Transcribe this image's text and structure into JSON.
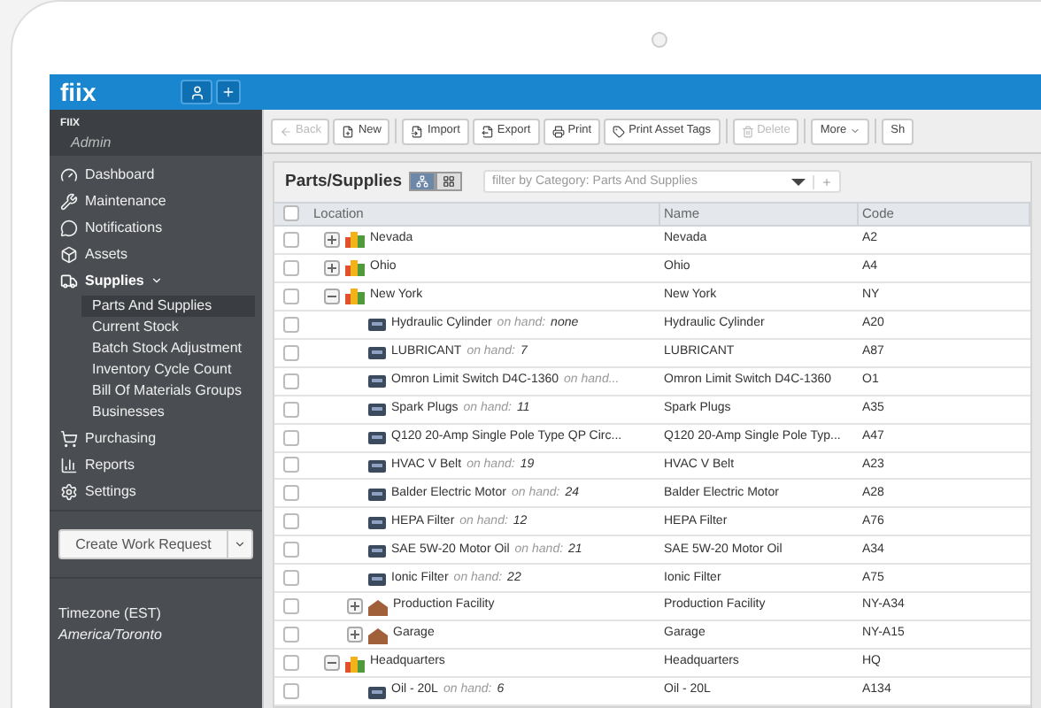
{
  "app": {
    "logo": "fiix",
    "account": {
      "company": "FIIX",
      "role": "Admin"
    }
  },
  "sidebar": {
    "items": [
      {
        "label": "Dashboard",
        "selected": false
      },
      {
        "label": "Maintenance",
        "selected": false
      },
      {
        "label": "Notifications",
        "selected": false
      },
      {
        "label": "Assets",
        "selected": false
      },
      {
        "label": "Supplies",
        "selected": true,
        "expanded": true,
        "children": [
          {
            "label": "Parts And Supplies",
            "selected": true
          },
          {
            "label": "Current Stock",
            "selected": false
          },
          {
            "label": "Batch Stock Adjustment",
            "selected": false
          },
          {
            "label": "Inventory Cycle Count",
            "selected": false
          },
          {
            "label": "Bill Of Materials Groups",
            "selected": false
          },
          {
            "label": "Businesses",
            "selected": false
          }
        ]
      },
      {
        "label": "Purchasing",
        "selected": false
      },
      {
        "label": "Reports",
        "selected": false
      },
      {
        "label": "Settings",
        "selected": false
      }
    ],
    "action_button": "Create Work Request",
    "timezone": {
      "label": "Timezone (EST)",
      "value": "America/Toronto"
    }
  },
  "toolbar": [
    {
      "label": "Back",
      "disabled": true
    },
    {
      "label": "New",
      "disabled": false
    },
    {
      "label": "Import",
      "disabled": false
    },
    {
      "label": "Export",
      "disabled": false
    },
    {
      "label": "Print",
      "disabled": false
    },
    {
      "label": "Print Asset Tags",
      "disabled": false
    },
    {
      "label": "Delete",
      "disabled": true
    },
    {
      "label": "More",
      "disabled": false
    },
    {
      "label": "Sh",
      "disabled": false
    }
  ],
  "panel": {
    "title": "Parts/Supplies",
    "views": [
      {
        "kind": "tree",
        "selected": true
      },
      {
        "kind": "grid",
        "selected": false
      }
    ],
    "filter": {
      "placeholder": "filter by Category: Parts And Supplies"
    }
  },
  "table": {
    "columns": [
      "Location",
      "Name",
      "Code"
    ],
    "all_checked": false,
    "rows": [
      {
        "kind": "site",
        "location": "Nevada",
        "name": "Nevada",
        "code": "A2",
        "checked": false,
        "expanded": false
      },
      {
        "kind": "site",
        "location": "Ohio",
        "name": "Ohio",
        "code": "A4",
        "checked": false,
        "expanded": false
      },
      {
        "kind": "site",
        "location": "New York",
        "name": "New York",
        "code": "NY",
        "checked": false,
        "expanded": true,
        "children": [
          {
            "kind": "part",
            "location": "Hydraulic Cylinder",
            "on_hand_label": "on hand:",
            "on_hand": "none",
            "name": "Hydraulic Cylinder",
            "code": "A20",
            "checked": false
          },
          {
            "kind": "part",
            "location": "LUBRICANT",
            "on_hand_label": "on hand:",
            "on_hand": "7",
            "name": "LUBRICANT",
            "code": "A87",
            "checked": false
          },
          {
            "kind": "part",
            "location": "Omron Limit Switch D4C-1360",
            "on_hand_label": "on hand...",
            "name": "Omron Limit Switch D4C-1360",
            "code": "O1",
            "checked": false
          },
          {
            "kind": "part",
            "location": "Spark Plugs",
            "on_hand_label": "on hand:",
            "on_hand": "11",
            "name": "Spark Plugs",
            "code": "A35",
            "checked": false
          },
          {
            "kind": "part",
            "location": "Q120 20-Amp Single Pole Type QP Circ...",
            "name": "Q120 20-Amp Single Pole Typ...",
            "code": "A47",
            "checked": false
          },
          {
            "kind": "part",
            "location": "HVAC V Belt",
            "on_hand_label": "on hand:",
            "on_hand": "19",
            "name": "HVAC V Belt",
            "code": "A23",
            "checked": false
          },
          {
            "kind": "part",
            "location": "Balder Electric Motor",
            "on_hand_label": "on hand:",
            "on_hand": "24",
            "name": "Balder Electric Motor",
            "code": "A28",
            "checked": false
          },
          {
            "kind": "part",
            "location": "HEPA Filter",
            "on_hand_label": "on hand:",
            "on_hand": "12",
            "name": "HEPA Filter",
            "code": "A76",
            "checked": false
          },
          {
            "kind": "part",
            "location": "SAE 5W-20 Motor Oil",
            "on_hand_label": "on hand:",
            "on_hand": "21",
            "name": "SAE 5W-20 Motor Oil",
            "code": "A34",
            "checked": false
          },
          {
            "kind": "part",
            "location": "Ionic Filter",
            "on_hand_label": "on hand:",
            "on_hand": "22",
            "name": "Ionic Filter",
            "code": "A75",
            "checked": false
          },
          {
            "kind": "facility",
            "location": "Production Facility",
            "name": "Production Facility",
            "code": "NY-A34",
            "checked": false,
            "expanded": false
          },
          {
            "kind": "facility",
            "location": "Garage",
            "name": "Garage",
            "code": "NY-A15",
            "checked": false,
            "expanded": false
          }
        ]
      },
      {
        "kind": "site",
        "location": "Headquarters",
        "name": "Headquarters",
        "code": "HQ",
        "checked": false,
        "expanded": true,
        "children": [
          {
            "kind": "part",
            "location": "Oil - 20L",
            "on_hand_label": "on hand:",
            "on_hand": "6",
            "name": "Oil - 20L",
            "code": "A134",
            "checked": false
          }
        ]
      }
    ]
  }
}
